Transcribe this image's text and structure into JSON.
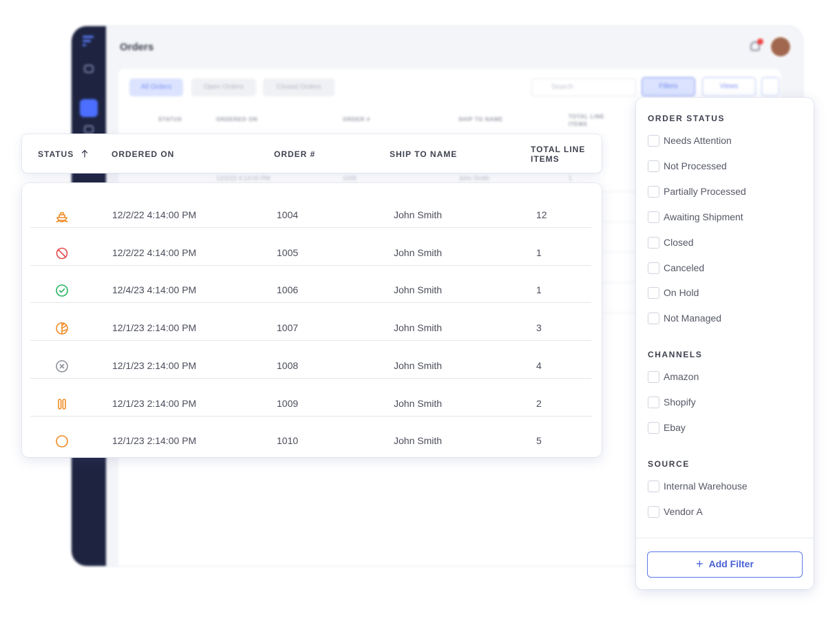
{
  "background_app": {
    "page_title": "Orders",
    "tabs": [
      "All Orders",
      "Open Orders",
      "Closed Orders"
    ],
    "search_placeholder": "Search",
    "filters_label": "Filters",
    "views_label": "Views",
    "headers": [
      "STATUS",
      "ORDERED ON",
      "ORDER #",
      "SHIP TO NAME",
      "TOTAL LINE ITEMS"
    ],
    "visible_row": {
      "ordered_on": "12/2/22 4:14:00 PM",
      "order_num": "1005",
      "ship_to": "John Smith",
      "total": "1"
    }
  },
  "table": {
    "headers": {
      "status": "STATUS",
      "ordered_on": "ORDERED ON",
      "order_num": "ORDER #",
      "ship_to": "SHIP TO NAME",
      "total_line_items": "TOTAL LINE ITEMS"
    },
    "rows": [
      {
        "status_icon": "ship-icon",
        "status_color": "#f08a24",
        "ordered_on": "12/2/22 4:14:00 PM",
        "order_num": "1004",
        "ship_to": "John Smith",
        "total": "12"
      },
      {
        "status_icon": "blocked-icon",
        "status_color": "#e5484d",
        "ordered_on": "12/2/22 4:14:00 PM",
        "order_num": "1005",
        "ship_to": "John Smith",
        "total": "1"
      },
      {
        "status_icon": "check-circle-icon",
        "status_color": "#22b35e",
        "ordered_on": "12/4/23 4:14:00 PM",
        "order_num": "1006",
        "ship_to": "John Smith",
        "total": "1"
      },
      {
        "status_icon": "half-circle-icon",
        "status_color": "#f08a24",
        "ordered_on": "12/1/23 2:14:00 PM",
        "order_num": "1007",
        "ship_to": "John Smith",
        "total": "3"
      },
      {
        "status_icon": "x-circle-icon",
        "status_color": "#8c8f9a",
        "ordered_on": "12/1/23 2:14:00 PM",
        "order_num": "1008",
        "ship_to": "John Smith",
        "total": "4"
      },
      {
        "status_icon": "pause-icon",
        "status_color": "#f08a24",
        "ordered_on": "12/1/23 2:14:00 PM",
        "order_num": "1009",
        "ship_to": "John Smith",
        "total": "2"
      },
      {
        "status_icon": "empty-circle-icon",
        "status_color": "#f08a24",
        "ordered_on": "12/1/23 2:14:00 PM",
        "order_num": "1010",
        "ship_to": "John Smith",
        "total": "5"
      }
    ]
  },
  "filter_panel": {
    "order_status": {
      "title": "ORDER STATUS",
      "options": [
        "Needs Attention",
        "Not Processed",
        "Partially Processed",
        "Awaiting Shipment",
        "Closed",
        "Canceled",
        "On Hold",
        "Not Managed"
      ]
    },
    "channels": {
      "title": "CHANNELS",
      "options": [
        "Amazon",
        "Shopify",
        "Ebay"
      ]
    },
    "source": {
      "title": "SOURCE",
      "options": [
        "Internal Warehouse",
        "Vendor A"
      ]
    },
    "add_filter_label": "Add Filter"
  },
  "colors": {
    "accent": "#4762d6",
    "sidebar": "#1e2440"
  }
}
